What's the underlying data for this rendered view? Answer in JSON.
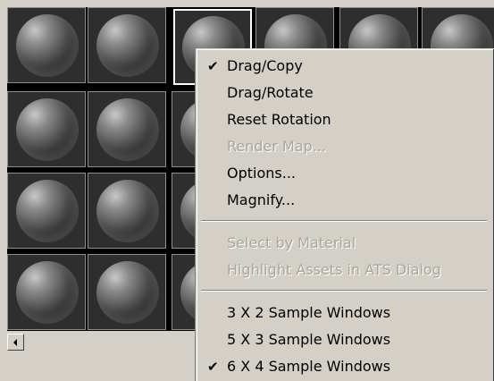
{
  "sample_grid": {
    "rows": 4,
    "columns": 6,
    "active_slot": "row 1, column 3"
  },
  "context_menu": {
    "items": [
      {
        "label": "Drag/Copy",
        "checked": true,
        "enabled": true
      },
      {
        "label": "Drag/Rotate",
        "checked": false,
        "enabled": true
      },
      {
        "label": "Reset Rotation",
        "checked": false,
        "enabled": true
      },
      {
        "label": "Render Map...",
        "checked": false,
        "enabled": false
      },
      {
        "label": "Options...",
        "checked": false,
        "enabled": true
      },
      {
        "label": "Magnify...",
        "checked": false,
        "enabled": true
      },
      {
        "label": "Select by Material",
        "checked": false,
        "enabled": false
      },
      {
        "label": "Highlight Assets in ATS Dialog",
        "checked": false,
        "enabled": false
      },
      {
        "label": "3 X 2 Sample Windows",
        "checked": false,
        "enabled": true
      },
      {
        "label": "5 X 3 Sample Windows",
        "checked": false,
        "enabled": true
      },
      {
        "label": "6 X 4 Sample Windows",
        "checked": true,
        "enabled": true
      }
    ],
    "check_glyph": "✔"
  },
  "icons": {
    "scroll_left": "left-arrow-icon",
    "checkmark": "checkmark-icon"
  },
  "colors": {
    "face": "#d4d0c8",
    "grid_background": "#000000",
    "disabled_text": "#a8a59c"
  }
}
